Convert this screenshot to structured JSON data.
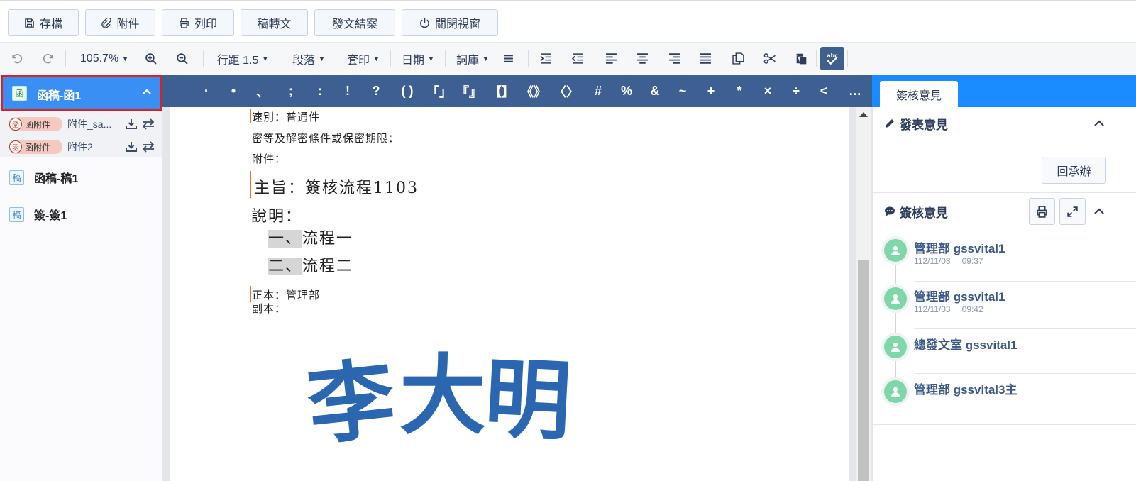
{
  "toolbar": {
    "save": "存檔",
    "attach": "附件",
    "print": "列印",
    "convert": "稿轉文",
    "close_case": "發文結案",
    "close_window": "關閉視窗"
  },
  "format": {
    "zoom": "105.7%",
    "line_spacing": "行距 1.5",
    "paragraph": "段落",
    "template": "套印",
    "date": "日期",
    "thesaurus": "詞庫"
  },
  "punctuation": [
    "·",
    "•",
    "、",
    ";",
    ":",
    "!",
    "?",
    "( )",
    "「」",
    "『』",
    "【】",
    "《》",
    "〈〉",
    "#",
    "%",
    "&",
    "~",
    "+",
    "*",
    "×",
    "÷",
    "<",
    "…"
  ],
  "sidebar": {
    "active": {
      "icon_char": "函",
      "label": "函稿-函1"
    },
    "attachments": [
      {
        "tag": "函附件",
        "tag_icon": "函",
        "name": "附件_sa..."
      },
      {
        "tag": "函附件",
        "tag_icon": "函",
        "name": "附件2"
      }
    ],
    "items": [
      {
        "icon_char": "稿",
        "label": "函稿-稿1"
      },
      {
        "icon_char": "稿",
        "label": "簽-簽1"
      }
    ]
  },
  "document": {
    "speed": "速別：普通件",
    "secrecy": "密等及解密條件或保密期限：",
    "attachment": "附件：",
    "subject": "主旨：簽核流程1103",
    "explain": "說明：",
    "item1_num": "一、",
    "item1_text": "流程一",
    "item2_num": "二、",
    "item2_text": "流程二",
    "original": "正本：管理部",
    "copy": "副本：",
    "seal": [
      "李",
      "大",
      "明"
    ]
  },
  "right": {
    "tab": "簽核意見",
    "publish_title": "發表意見",
    "return_button": "回承辦",
    "opinions_title": "簽核意見",
    "timeline": [
      {
        "name": "管理部 gssvital1",
        "date": "112/11/03",
        "time": "09:37"
      },
      {
        "name": "管理部 gssvital1",
        "date": "112/11/03",
        "time": "09:42"
      },
      {
        "name": "總發文室 gssvital1",
        "date": "",
        "time": ""
      },
      {
        "name": "管理部 gssvital3主",
        "date": "",
        "time": ""
      }
    ]
  },
  "colors": {
    "accent": "#3a8ff5",
    "punct_bar": "#3e5f91",
    "tab_bar": "#1a8cff",
    "seal": "#2b67b1",
    "avatar": "#7dd7a9"
  }
}
